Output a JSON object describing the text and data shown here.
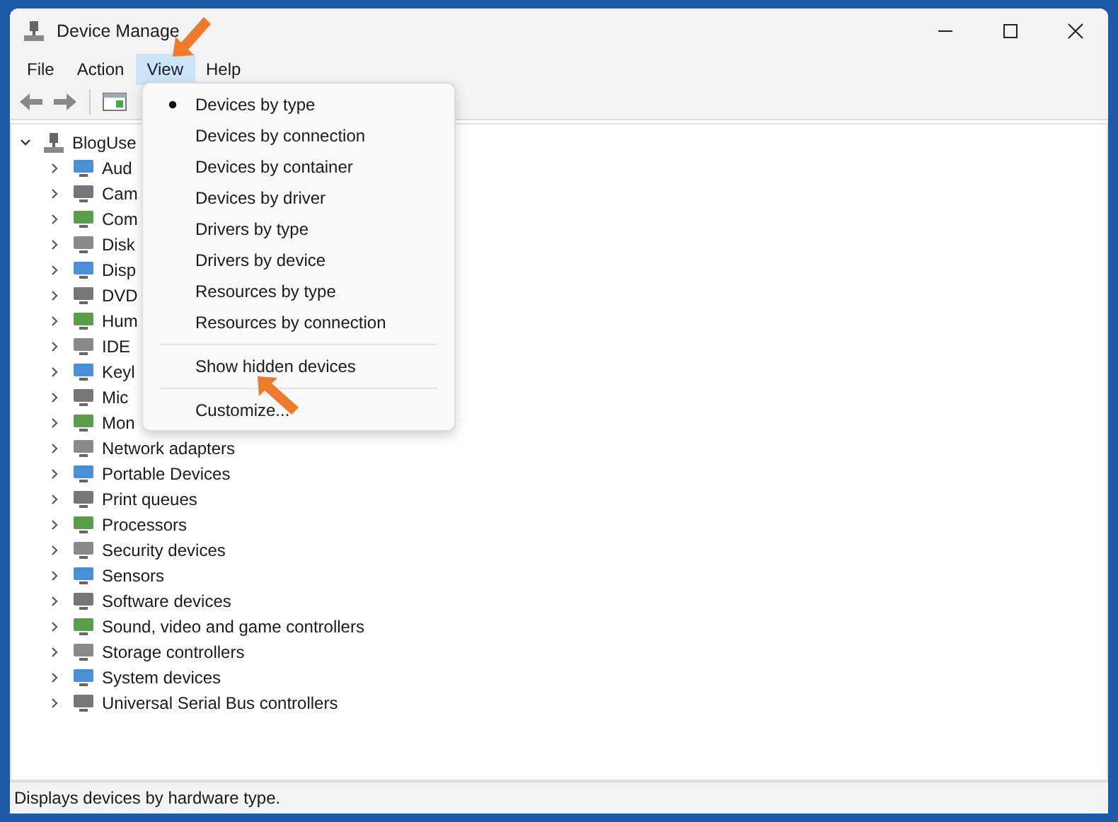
{
  "window": {
    "title": "Device Manage"
  },
  "menu_bar": [
    {
      "label": "File",
      "selected": false
    },
    {
      "label": "Action",
      "selected": false
    },
    {
      "label": "View",
      "selected": true
    },
    {
      "label": "Help",
      "selected": false
    }
  ],
  "tree": {
    "label": "BlogUse",
    "expanded": true,
    "children": [
      {
        "label": "Aud",
        "expanded": false
      },
      {
        "label": "Cam",
        "expanded": false
      },
      {
        "label": "Com",
        "expanded": false
      },
      {
        "label": "Disk",
        "expanded": false
      },
      {
        "label": "Disp",
        "expanded": false
      },
      {
        "label": "DVD",
        "expanded": false
      },
      {
        "label": "Hum",
        "expanded": false
      },
      {
        "label": "IDE",
        "expanded": false
      },
      {
        "label": "Keyl",
        "expanded": false
      },
      {
        "label": "Mic",
        "expanded": false
      },
      {
        "label": "Mon",
        "expanded": false
      },
      {
        "label": "Network adapters",
        "expanded": false
      },
      {
        "label": "Portable Devices",
        "expanded": false
      },
      {
        "label": "Print queues",
        "expanded": false
      },
      {
        "label": "Processors",
        "expanded": false
      },
      {
        "label": "Security devices",
        "expanded": false
      },
      {
        "label": "Sensors",
        "expanded": false
      },
      {
        "label": "Software devices",
        "expanded": false
      },
      {
        "label": "Sound, video and game controllers",
        "expanded": false
      },
      {
        "label": "Storage controllers",
        "expanded": false
      },
      {
        "label": "System devices",
        "expanded": false
      },
      {
        "label": "Universal Serial Bus controllers",
        "expanded": false
      }
    ]
  },
  "view_menu": [
    {
      "kind": "item",
      "label": "Devices by type",
      "selected": true
    },
    {
      "kind": "item",
      "label": "Devices by connection",
      "selected": false
    },
    {
      "kind": "item",
      "label": "Devices by container",
      "selected": false
    },
    {
      "kind": "item",
      "label": "Devices by driver",
      "selected": false
    },
    {
      "kind": "item",
      "label": "Drivers by type",
      "selected": false
    },
    {
      "kind": "item",
      "label": "Drivers by device",
      "selected": false
    },
    {
      "kind": "item",
      "label": "Resources by type",
      "selected": false
    },
    {
      "kind": "item",
      "label": "Resources by connection",
      "selected": false
    },
    {
      "kind": "separator"
    },
    {
      "kind": "item",
      "label": "Show hidden devices",
      "selected": false
    },
    {
      "kind": "separator"
    },
    {
      "kind": "item",
      "label": "Customize...",
      "selected": false
    }
  ],
  "status_bar": "Displays devices by hardware type."
}
